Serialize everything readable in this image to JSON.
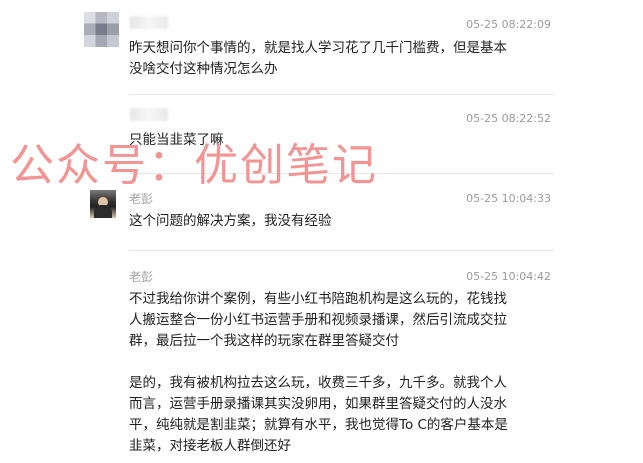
{
  "messages": [
    {
      "sender": "",
      "time": "05-25 08:22:09",
      "text": "昨天想问你个事情的，就是找人学习花了几千门槛费，但是基本\n没啥交付这种情况怎么办"
    },
    {
      "sender": "",
      "time": "05-25 08:22:52",
      "text": "只能当韭菜了嘛"
    },
    {
      "sender": "老彭",
      "time": "05-25 10:04:33",
      "text": "这个问题的解决方案，我没有经验"
    },
    {
      "sender": "老彭",
      "time": "05-25 10:04:42",
      "text": "不过我给你讲个案例，有些小红书陪跑机构是这么玩的，花钱找\n人搬运整合一份小红书运营手册和视频录播课，然后引流成交拉\n群，最后拉一个我这样的玩家在群里答疑交付\n\n是的，我有被机构拉去这么玩，收费三千多，九千多。就我个人\n而言，运营手册录播课其实没卵用，如果群里答疑交付的人没水\n平，纯纯就是割韭菜；就算有水平，我也觉得To C的客户基本是\n韭菜，对接老板人群倒还好"
    }
  ],
  "watermark": "公众号：优创笔记"
}
